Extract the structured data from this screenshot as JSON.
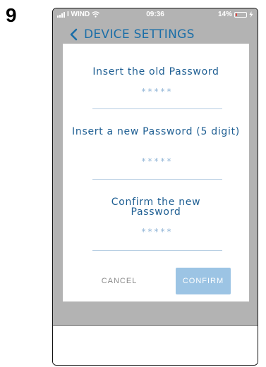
{
  "step_number": "9",
  "status_bar": {
    "carrier": "I WIND",
    "time": "09:36",
    "battery_percent": "14%",
    "battery_level": 0.14,
    "battery_color": "#e0403c"
  },
  "header": {
    "title": "DEVICE SETTINGS",
    "back_icon": "chevron-left-icon",
    "accent_color": "#1a6ea8"
  },
  "dialog": {
    "old_password": {
      "label": "Insert the old Password",
      "value": "*****"
    },
    "new_password": {
      "label": "Insert a new Password (5 digit)",
      "value": "*****"
    },
    "confirm_password": {
      "label": "Confirm the new Password",
      "value": "*****"
    },
    "cancel_label": "CANCEL",
    "confirm_label": "CONFIRM",
    "confirm_color": "#9cc4e4"
  }
}
